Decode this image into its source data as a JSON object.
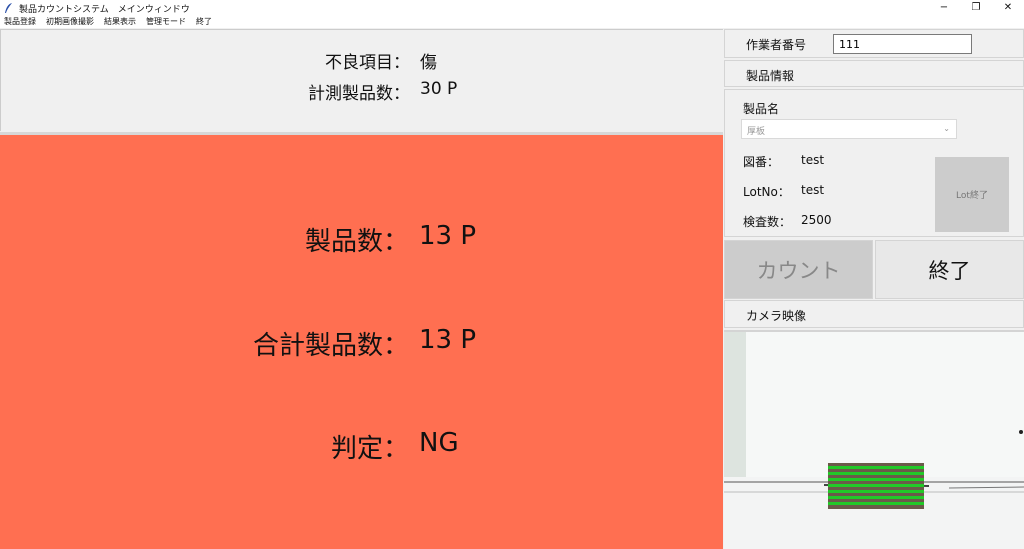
{
  "window": {
    "title": "製品カウントシステム　メインウィンドウ",
    "controls": [
      "−",
      "❐",
      "✕"
    ]
  },
  "menu": [
    "製品登録",
    "初期画像撮影",
    "結果表示",
    "管理モード",
    "終了"
  ],
  "top": {
    "defect_label": "不良項目：",
    "defect_value": "傷",
    "measured_label": "計測製品数：",
    "measured_value": "30 P"
  },
  "result": {
    "count_label": "製品数：",
    "count_value": "13 P",
    "total_label": "合計製品数：",
    "total_value": "13 P",
    "judge_label": "判定：",
    "judge_value": "NG",
    "bg_color": "#ff6f51"
  },
  "side": {
    "worker_label": "作業者番号",
    "worker_value": "111",
    "product_info_label": "製品情報",
    "product_name_label": "製品名",
    "product_name_value": "厚板",
    "drawing_label": "図番：",
    "drawing_value": "test",
    "lot_label": "LotNo：",
    "lot_value": "test",
    "inspect_label": "検査数：",
    "inspect_value": "2500",
    "lot_end_button": "Lot終了",
    "count_button": "カウント",
    "end_button": "終了",
    "camera_label": "カメラ映像"
  }
}
